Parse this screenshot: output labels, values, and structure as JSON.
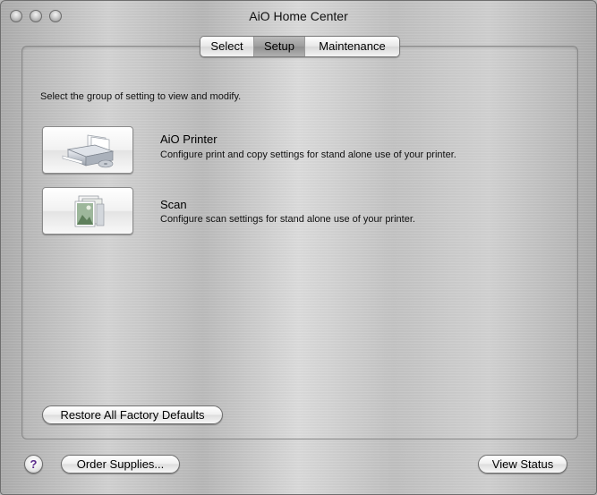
{
  "window": {
    "title": "AiO Home Center"
  },
  "tabs": [
    {
      "label": "Select",
      "selected": false
    },
    {
      "label": "Setup",
      "selected": true
    },
    {
      "label": "Maintenance",
      "selected": false
    }
  ],
  "main": {
    "instruction": "Select the group of setting to view and modify.",
    "items": [
      {
        "icon": "printer-icon",
        "title": "AiO Printer",
        "description": "Configure print and copy settings for stand alone use of your printer."
      },
      {
        "icon": "scan-icon",
        "title": "Scan",
        "description": "Configure scan settings for stand alone use of your printer."
      }
    ],
    "restore_label": "Restore All Factory Defaults"
  },
  "footer": {
    "help_label": "?",
    "order_label": "Order Supplies...",
    "status_label": "View Status"
  },
  "colors": {
    "help_glyph": "#5a2a8a",
    "selected_tab": "#a3a3a3"
  }
}
